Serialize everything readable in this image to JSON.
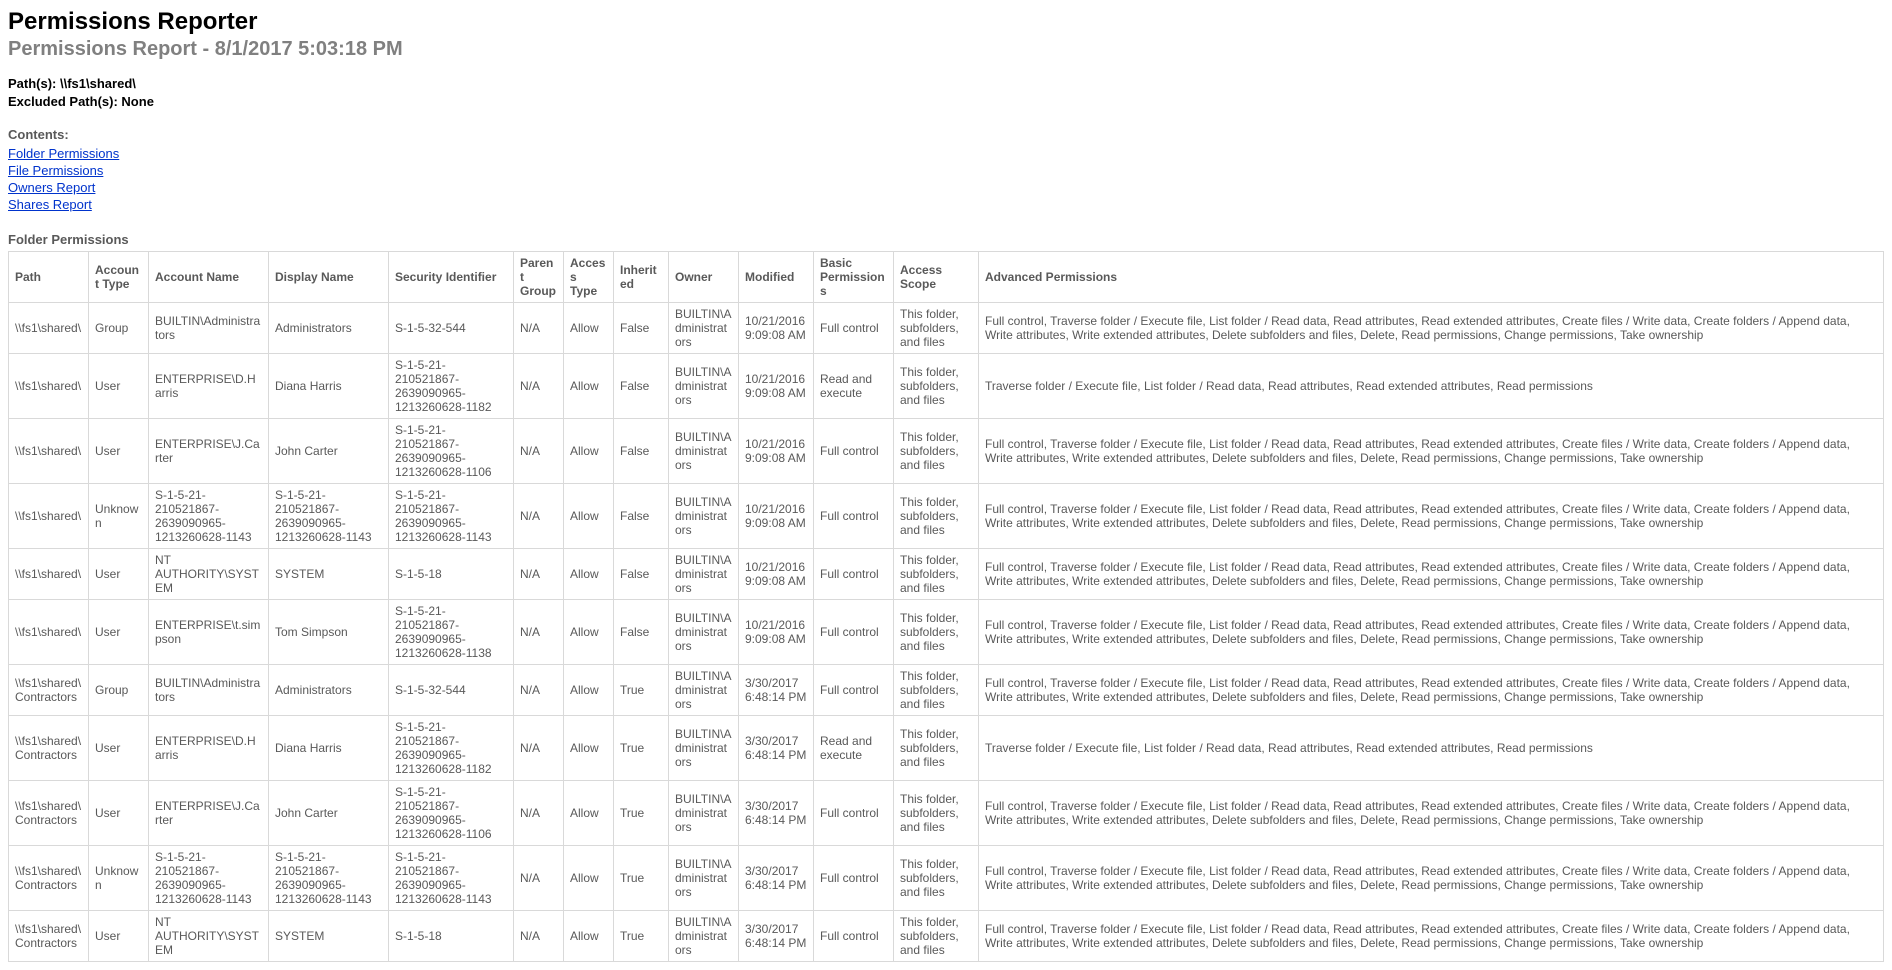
{
  "header": {
    "title": "Permissions Reporter",
    "subtitle": "Permissions Report - 8/1/2017 5:03:18 PM",
    "paths_label": "Path(s): ",
    "paths_value": "\\\\fs1\\shared\\",
    "excluded_label": "Excluded Path(s): ",
    "excluded_value": "None"
  },
  "contents": {
    "label": "Contents:",
    "links": {
      "folder": "Folder Permissions",
      "file": "File Permissions",
      "owners": "Owners Report",
      "shares": "Shares Report"
    }
  },
  "section": {
    "title": "Folder Permissions"
  },
  "table": {
    "headers": {
      "path": "Path",
      "account_type": "Account Type",
      "account_name": "Account Name",
      "display_name": "Display Name",
      "sid": "Security Identifier",
      "parent_group": "Parent Group",
      "access_type": "Access Type",
      "inherited": "Inherited",
      "owner": "Owner",
      "modified": "Modified",
      "basic": "Basic Permissions",
      "scope": "Access Scope",
      "advanced": "Advanced Permissions"
    },
    "rows": [
      {
        "path": "\\\\fs1\\shared\\",
        "account_type": "Group",
        "account_name": "BUILTIN\\Administrators",
        "display_name": "Administrators",
        "sid": "S-1-5-32-544",
        "parent_group": "N/A",
        "access_type": "Allow",
        "inherited": "False",
        "owner": "BUILTIN\\Administrators",
        "modified": "10/21/2016 9:09:08 AM",
        "basic": "Full control",
        "scope": "This folder, subfolders, and files",
        "advanced": "Full control, Traverse folder / Execute file, List folder / Read data, Read attributes, Read extended attributes, Create files / Write data, Create folders / Append data, Write attributes, Write extended attributes, Delete subfolders and files, Delete, Read permissions, Change permissions, Take ownership"
      },
      {
        "path": "\\\\fs1\\shared\\",
        "account_type": "User",
        "account_name": "ENTERPRISE\\D.Harris",
        "display_name": "Diana Harris",
        "sid": "S-1-5-21-210521867-2639090965-1213260628-1182",
        "parent_group": "N/A",
        "access_type": "Allow",
        "inherited": "False",
        "owner": "BUILTIN\\Administrators",
        "modified": "10/21/2016 9:09:08 AM",
        "basic": "Read and execute",
        "scope": "This folder, subfolders, and files",
        "advanced": "Traverse folder / Execute file, List folder / Read data, Read attributes, Read extended attributes, Read permissions"
      },
      {
        "path": "\\\\fs1\\shared\\",
        "account_type": "User",
        "account_name": "ENTERPRISE\\J.Carter",
        "display_name": "John Carter",
        "sid": "S-1-5-21-210521867-2639090965-1213260628-1106",
        "parent_group": "N/A",
        "access_type": "Allow",
        "inherited": "False",
        "owner": "BUILTIN\\Administrators",
        "modified": "10/21/2016 9:09:08 AM",
        "basic": "Full control",
        "scope": "This folder, subfolders, and files",
        "advanced": "Full control, Traverse folder / Execute file, List folder / Read data, Read attributes, Read extended attributes, Create files / Write data, Create folders / Append data, Write attributes, Write extended attributes, Delete subfolders and files, Delete, Read permissions, Change permissions, Take ownership"
      },
      {
        "path": "\\\\fs1\\shared\\",
        "account_type": "Unknown",
        "account_name": "S-1-5-21-210521867-2639090965-1213260628-1143",
        "display_name": "S-1-5-21-210521867-2639090965-1213260628-1143",
        "sid": "S-1-5-21-210521867-2639090965-1213260628-1143",
        "parent_group": "N/A",
        "access_type": "Allow",
        "inherited": "False",
        "owner": "BUILTIN\\Administrators",
        "modified": "10/21/2016 9:09:08 AM",
        "basic": "Full control",
        "scope": "This folder, subfolders, and files",
        "advanced": "Full control, Traverse folder / Execute file, List folder / Read data, Read attributes, Read extended attributes, Create files / Write data, Create folders / Append data, Write attributes, Write extended attributes, Delete subfolders and files, Delete, Read permissions, Change permissions, Take ownership"
      },
      {
        "path": "\\\\fs1\\shared\\",
        "account_type": "User",
        "account_name": "NT AUTHORITY\\SYSTEM",
        "display_name": "SYSTEM",
        "sid": "S-1-5-18",
        "parent_group": "N/A",
        "access_type": "Allow",
        "inherited": "False",
        "owner": "BUILTIN\\Administrators",
        "modified": "10/21/2016 9:09:08 AM",
        "basic": "Full control",
        "scope": "This folder, subfolders, and files",
        "advanced": "Full control, Traverse folder / Execute file, List folder / Read data, Read attributes, Read extended attributes, Create files / Write data, Create folders / Append data, Write attributes, Write extended attributes, Delete subfolders and files, Delete, Read permissions, Change permissions, Take ownership"
      },
      {
        "path": "\\\\fs1\\shared\\",
        "account_type": "User",
        "account_name": "ENTERPRISE\\t.simpson",
        "display_name": "Tom Simpson",
        "sid": "S-1-5-21-210521867-2639090965-1213260628-1138",
        "parent_group": "N/A",
        "access_type": "Allow",
        "inherited": "False",
        "owner": "BUILTIN\\Administrators",
        "modified": "10/21/2016 9:09:08 AM",
        "basic": "Full control",
        "scope": "This folder, subfolders, and files",
        "advanced": "Full control, Traverse folder / Execute file, List folder / Read data, Read attributes, Read extended attributes, Create files / Write data, Create folders / Append data, Write attributes, Write extended attributes, Delete subfolders and files, Delete, Read permissions, Change permissions, Take ownership"
      },
      {
        "path": "\\\\fs1\\shared\\Contractors",
        "account_type": "Group",
        "account_name": "BUILTIN\\Administrators",
        "display_name": "Administrators",
        "sid": "S-1-5-32-544",
        "parent_group": "N/A",
        "access_type": "Allow",
        "inherited": "True",
        "owner": "BUILTIN\\Administrators",
        "modified": "3/30/2017 6:48:14 PM",
        "basic": "Full control",
        "scope": "This folder, subfolders, and files",
        "advanced": "Full control, Traverse folder / Execute file, List folder / Read data, Read attributes, Read extended attributes, Create files / Write data, Create folders / Append data, Write attributes, Write extended attributes, Delete subfolders and files, Delete, Read permissions, Change permissions, Take ownership"
      },
      {
        "path": "\\\\fs1\\shared\\Contractors",
        "account_type": "User",
        "account_name": "ENTERPRISE\\D.Harris",
        "display_name": "Diana Harris",
        "sid": "S-1-5-21-210521867-2639090965-1213260628-1182",
        "parent_group": "N/A",
        "access_type": "Allow",
        "inherited": "True",
        "owner": "BUILTIN\\Administrators",
        "modified": "3/30/2017 6:48:14 PM",
        "basic": "Read and execute",
        "scope": "This folder, subfolders, and files",
        "advanced": "Traverse folder / Execute file, List folder / Read data, Read attributes, Read extended attributes, Read permissions"
      },
      {
        "path": "\\\\fs1\\shared\\Contractors",
        "account_type": "User",
        "account_name": "ENTERPRISE\\J.Carter",
        "display_name": "John Carter",
        "sid": "S-1-5-21-210521867-2639090965-1213260628-1106",
        "parent_group": "N/A",
        "access_type": "Allow",
        "inherited": "True",
        "owner": "BUILTIN\\Administrators",
        "modified": "3/30/2017 6:48:14 PM",
        "basic": "Full control",
        "scope": "This folder, subfolders, and files",
        "advanced": "Full control, Traverse folder / Execute file, List folder / Read data, Read attributes, Read extended attributes, Create files / Write data, Create folders / Append data, Write attributes, Write extended attributes, Delete subfolders and files, Delete, Read permissions, Change permissions, Take ownership"
      },
      {
        "path": "\\\\fs1\\shared\\Contractors",
        "account_type": "Unknown",
        "account_name": "S-1-5-21-210521867-2639090965-1213260628-1143",
        "display_name": "S-1-5-21-210521867-2639090965-1213260628-1143",
        "sid": "S-1-5-21-210521867-2639090965-1213260628-1143",
        "parent_group": "N/A",
        "access_type": "Allow",
        "inherited": "True",
        "owner": "BUILTIN\\Administrators",
        "modified": "3/30/2017 6:48:14 PM",
        "basic": "Full control",
        "scope": "This folder, subfolders, and files",
        "advanced": "Full control, Traverse folder / Execute file, List folder / Read data, Read attributes, Read extended attributes, Create files / Write data, Create folders / Append data, Write attributes, Write extended attributes, Delete subfolders and files, Delete, Read permissions, Change permissions, Take ownership"
      },
      {
        "path": "\\\\fs1\\shared\\Contractors",
        "account_type": "User",
        "account_name": "NT AUTHORITY\\SYSTEM",
        "display_name": "SYSTEM",
        "sid": "S-1-5-18",
        "parent_group": "N/A",
        "access_type": "Allow",
        "inherited": "True",
        "owner": "BUILTIN\\Administrators",
        "modified": "3/30/2017 6:48:14 PM",
        "basic": "Full control",
        "scope": "This folder, subfolders, and files",
        "advanced": "Full control, Traverse folder / Execute file, List folder / Read data, Read attributes, Read extended attributes, Create files / Write data, Create folders / Append data, Write attributes, Write extended attributes, Delete subfolders and files, Delete, Read permissions, Change permissions, Take ownership"
      }
    ]
  }
}
